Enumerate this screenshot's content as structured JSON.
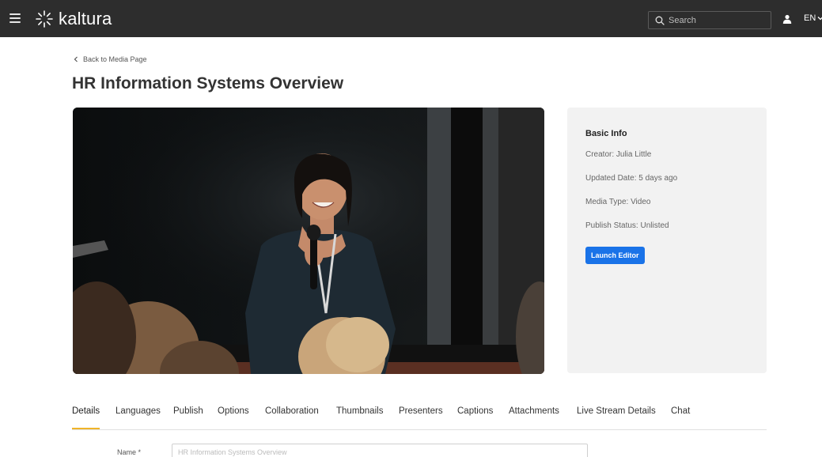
{
  "header": {
    "logo_text": "kaltura",
    "search_placeholder": "Search",
    "language": "EN"
  },
  "back_link": "Back to Media Page",
  "page_title": "HR Information Systems Overview",
  "basic_info": {
    "heading": "Basic Info",
    "creator": "Creator: Julia Little",
    "updated": "Updated Date: 5 days ago",
    "media_type": "Media Type: Video",
    "publish_status": "Publish Status: Unlisted",
    "launch_editor": "Launch Editor"
  },
  "tabs": [
    {
      "label": "Details"
    },
    {
      "label": "Languages"
    },
    {
      "label": "Publish"
    },
    {
      "label": "Options"
    },
    {
      "label": "Collaboration"
    },
    {
      "label": "Thumbnails"
    },
    {
      "label": "Presenters"
    },
    {
      "label": "Captions"
    },
    {
      "label": "Attachments"
    },
    {
      "label": "Live Stream Details"
    },
    {
      "label": "Chat"
    }
  ],
  "active_tab": "Details",
  "form": {
    "name_label": "Name *",
    "name_value": "HR Information Systems Overview"
  },
  "colors": {
    "header_bg": "#2d2d2d",
    "accent_button": "#1a73e8",
    "active_tab_underline": "#f0b429",
    "panel_bg": "#f2f2f2"
  }
}
